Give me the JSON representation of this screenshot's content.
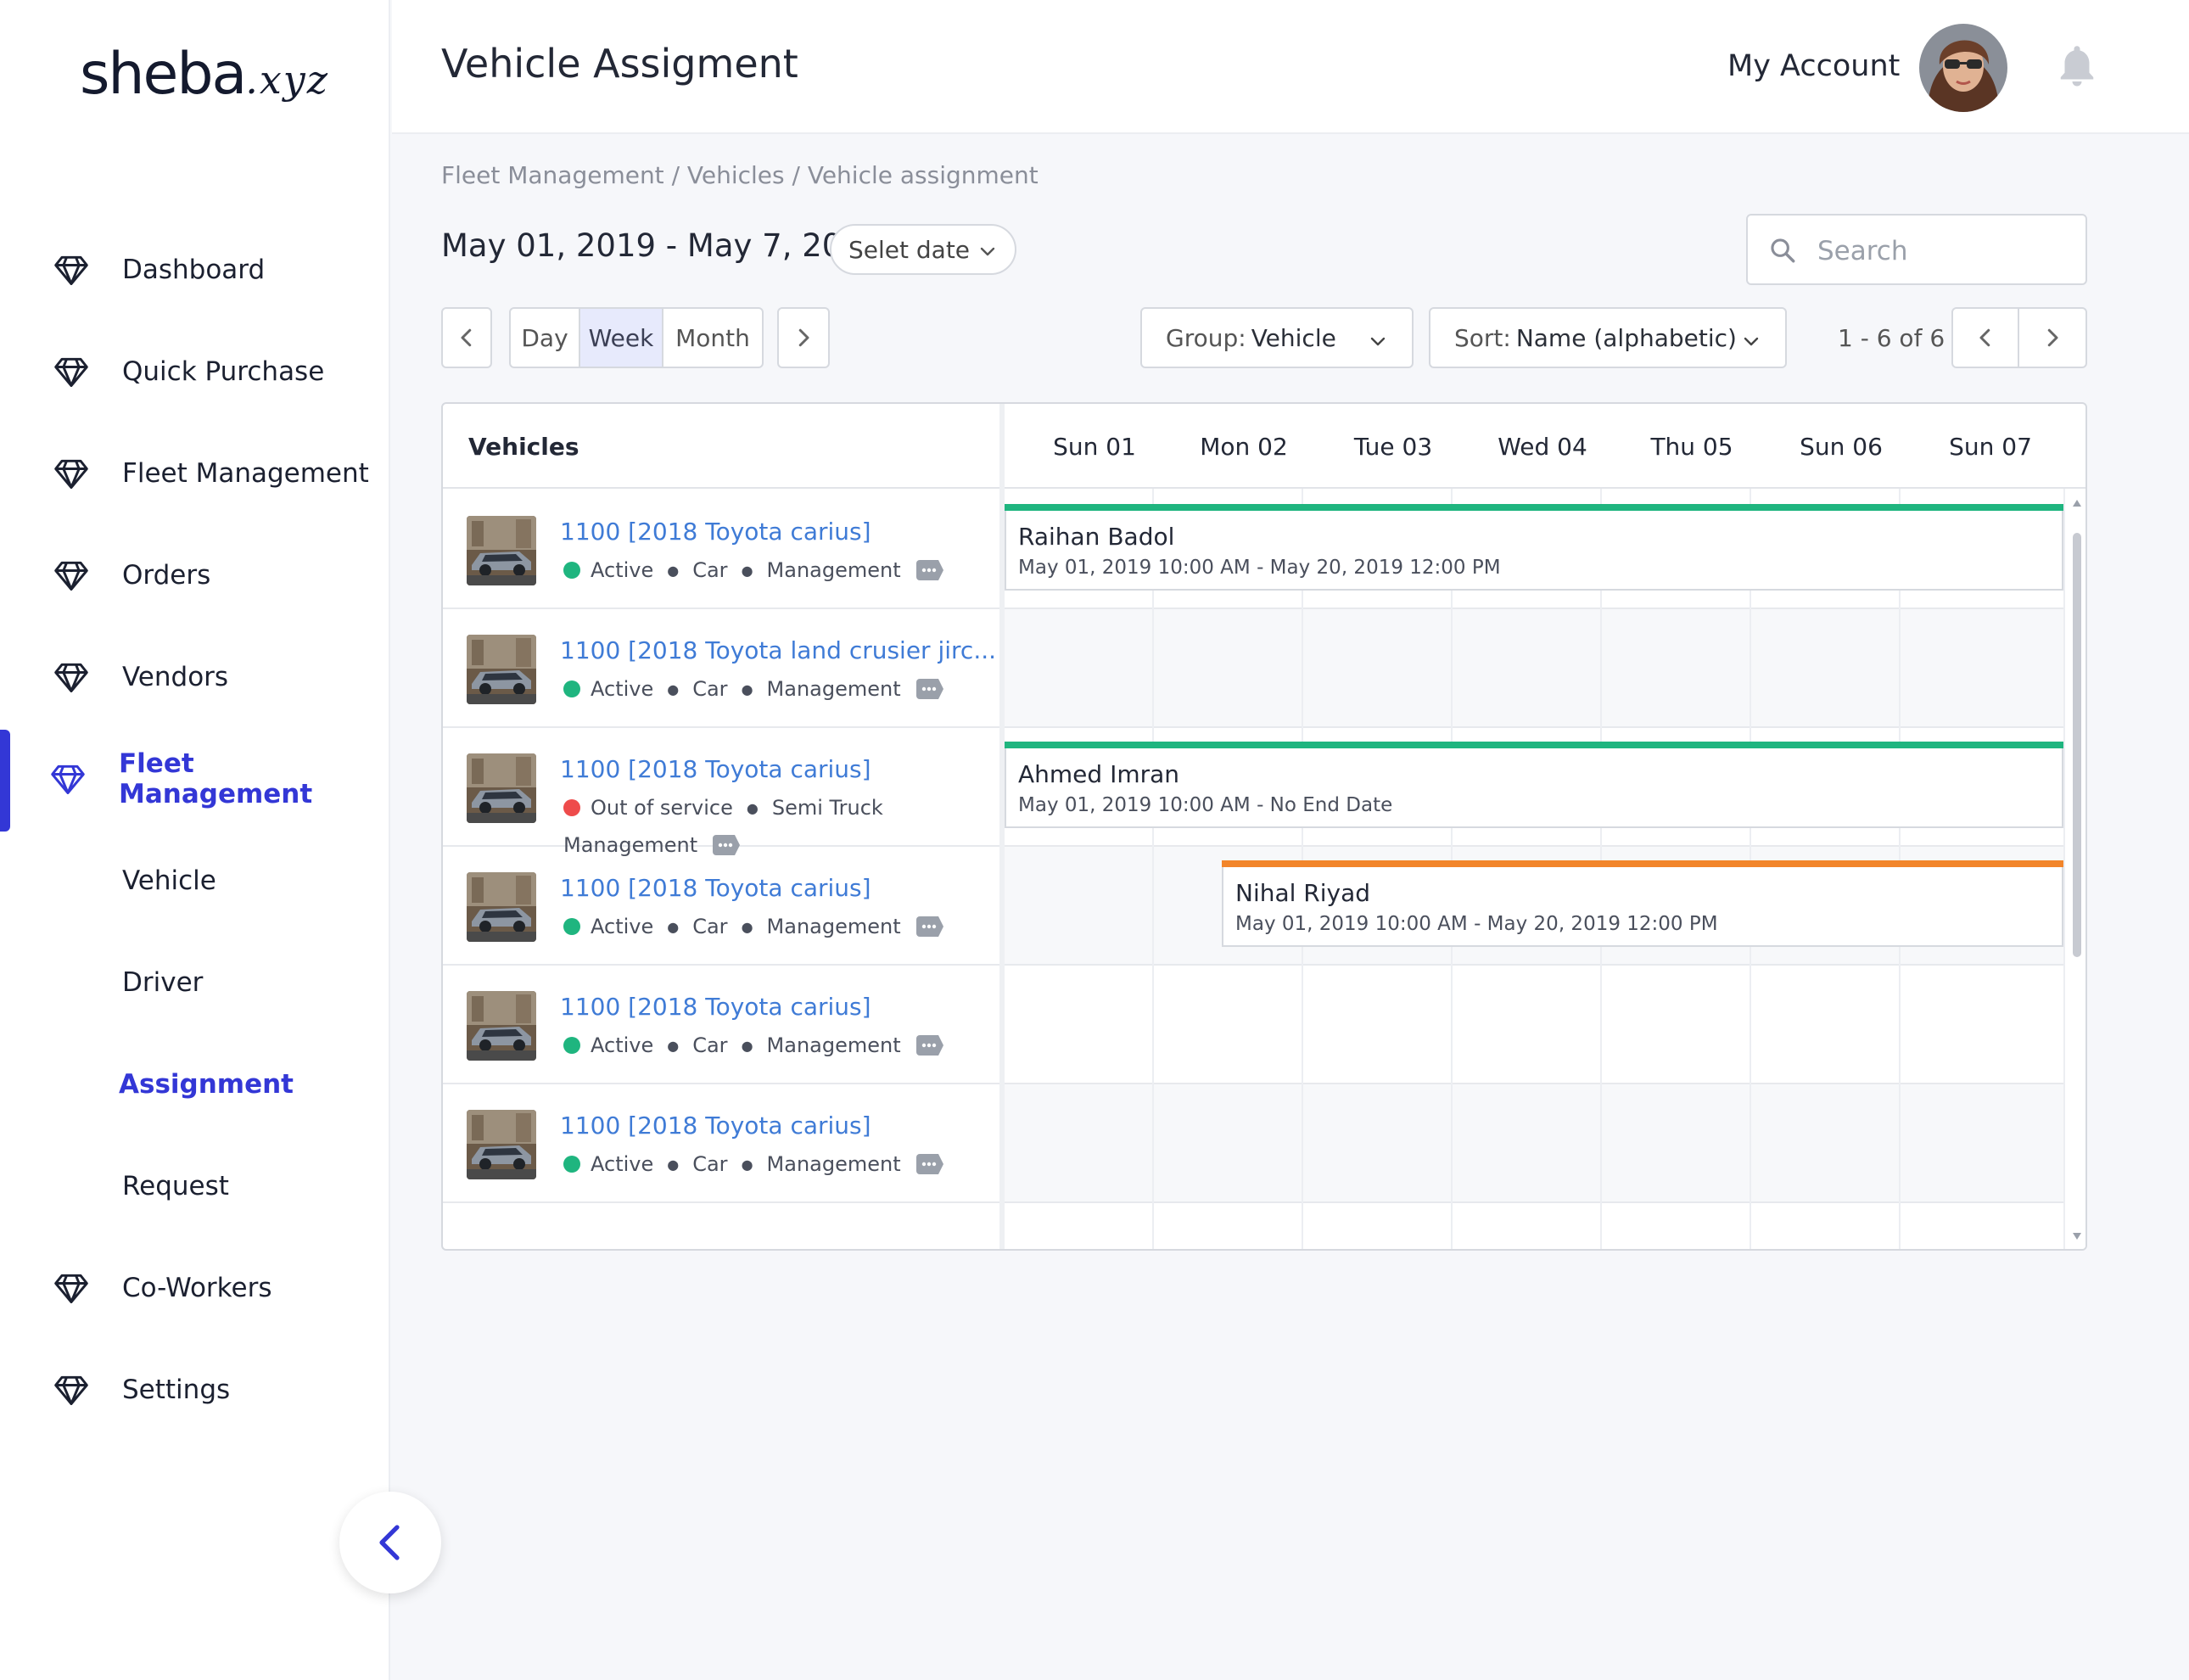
{
  "brand": {
    "name": "sheba",
    "ext": ".xyz"
  },
  "sidebar": {
    "items": [
      {
        "label": "Dashboard"
      },
      {
        "label": "Quick Purchase"
      },
      {
        "label": "Fleet Management"
      },
      {
        "label": "Orders"
      },
      {
        "label": "Vendors"
      },
      {
        "label": "Fleet Management",
        "active": true
      },
      {
        "label": "Vehicle"
      },
      {
        "label": "Driver"
      },
      {
        "label": "Assignment",
        "active": true
      },
      {
        "label": "Request"
      },
      {
        "label": "Co-Workers"
      },
      {
        "label": "Settings"
      }
    ],
    "collapse_icon": "chevron-left-icon"
  },
  "header": {
    "title": "Vehicle Assigment",
    "account_label": "My Account",
    "bell_icon": "bell-icon"
  },
  "breadcrumb": "Fleet Management / Vehicles / Vehicle assignment",
  "toolbar": {
    "date_range": "May 01, 2019 - May 7, 2019",
    "select_date": "Selet date",
    "search_placeholder": "Search",
    "views": [
      "Day",
      "Week",
      "Month"
    ],
    "active_view": "Week",
    "group_prefix": "Group:",
    "group_value": "Vehicle",
    "sort_prefix": "Sort:",
    "sort_value": "Name (alphabetic)",
    "pager_text": "1 - 6 of 6"
  },
  "grid": {
    "vehicles_header": "Vehicles",
    "days": [
      "Sun 01",
      "Mon 02",
      "Tue 03",
      "Wed 04",
      "Thu 05",
      "Sun 06",
      "Sun 07"
    ],
    "rows": [
      {
        "title": "1100 [2018 Toyota carius]",
        "status": "Active",
        "status_color": "#1fb57f",
        "type": "Car",
        "dept": "Management"
      },
      {
        "title": "1100 [2018 Toyota land crusier jirc...",
        "status": "Active",
        "status_color": "#1fb57f",
        "type": "Car",
        "dept": "Management"
      },
      {
        "title": "1100 [2018 Toyota carius]",
        "status": "Out of service",
        "status_color": "#ee4b4b",
        "type": "Semi Truck",
        "dept": "Management"
      },
      {
        "title": "1100 [2018 Toyota carius]",
        "status": "Active",
        "status_color": "#1fb57f",
        "type": "Car",
        "dept": "Management"
      },
      {
        "title": "1100 [2018 Toyota carius]",
        "status": "Active",
        "status_color": "#1fb57f",
        "type": "Car",
        "dept": "Management"
      },
      {
        "title": "1100 [2018 Toyota carius]",
        "status": "Active",
        "status_color": "#1fb57f",
        "type": "Car",
        "dept": "Management"
      }
    ],
    "bookings": [
      {
        "name": "Raihan Badol",
        "range": "May 01, 2019 10:00 AM - May 20, 2019 12:00 PM",
        "color": "#1fb57f"
      },
      {
        "name": "Ahmed Imran",
        "range": "May 01, 2019 10:00 AM - No End Date",
        "color": "#1fb57f"
      },
      {
        "name": "Nihal Riyad",
        "range": "May 01, 2019 10:00 AM - May 20, 2019 12:00 PM",
        "color": "#f2852a"
      }
    ]
  },
  "colors": {
    "accent": "#3337d6",
    "link": "#3f7bd6",
    "active": "#1fb57f",
    "out_of_service": "#ee4b4b",
    "warning_bar": "#f2852a"
  }
}
